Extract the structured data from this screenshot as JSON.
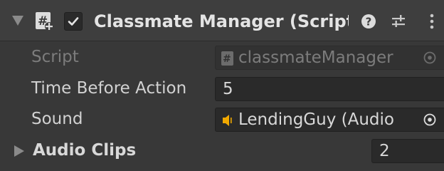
{
  "header": {
    "title": "Classmate Manager (Script)",
    "enabled": true,
    "icons": [
      "foldout-arrow-icon",
      "csharp-script-icon",
      "checkmark-icon",
      "help-icon",
      "preset-icon",
      "context-menu-icon"
    ]
  },
  "properties": {
    "script": {
      "label": "Script",
      "value": "classmateManager",
      "icon": "csharp-script-icon"
    },
    "time_before_action": {
      "label": "Time Before Action",
      "value": "5"
    },
    "sound": {
      "label": "Sound",
      "value": "LendingGuy (Audio",
      "icon": "audio-source-icon"
    },
    "audio_clips": {
      "label": "Audio Clips",
      "size": "2"
    }
  },
  "colors": {
    "panel_bg": "#383838",
    "header_bg": "#3e3e3e",
    "field_bg": "#2a2a2a",
    "text": "#d2d2d2",
    "disabled_text": "#7c7c7c",
    "audio_icon": "#f0a800"
  }
}
